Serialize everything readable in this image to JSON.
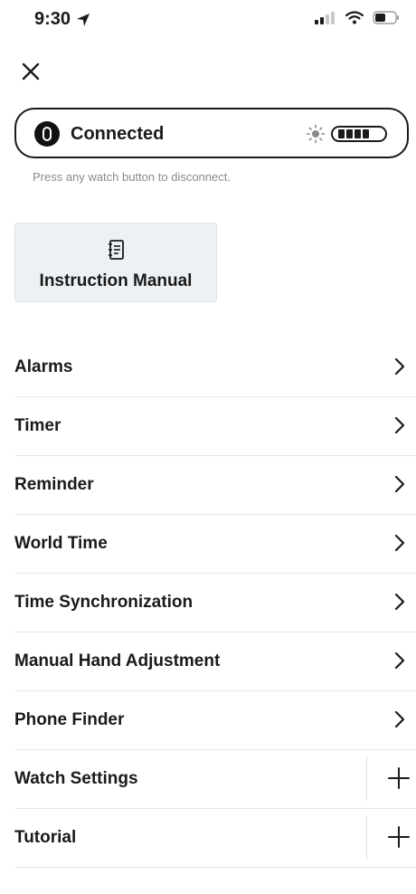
{
  "status": {
    "time": "9:30",
    "icons": [
      "location-arrow-icon",
      "signal-icon",
      "wifi-icon",
      "battery-icon"
    ]
  },
  "close_icon": "close-icon",
  "connection": {
    "label": "Connected",
    "brightness_icon": "sun-icon",
    "battery_level": "full",
    "hint": "Press any watch button to disconnect."
  },
  "manual": {
    "icon": "manual-icon",
    "label": "Instruction Manual"
  },
  "menu": [
    {
      "label": "Alarms",
      "action": "chevron"
    },
    {
      "label": "Timer",
      "action": "chevron"
    },
    {
      "label": "Reminder",
      "action": "chevron"
    },
    {
      "label": "World Time",
      "action": "chevron"
    },
    {
      "label": "Time Synchronization",
      "action": "chevron"
    },
    {
      "label": "Manual Hand Adjustment",
      "action": "chevron"
    },
    {
      "label": "Phone Finder",
      "action": "chevron"
    },
    {
      "label": "Watch Settings",
      "action": "expand"
    },
    {
      "label": "Tutorial",
      "action": "expand"
    }
  ]
}
